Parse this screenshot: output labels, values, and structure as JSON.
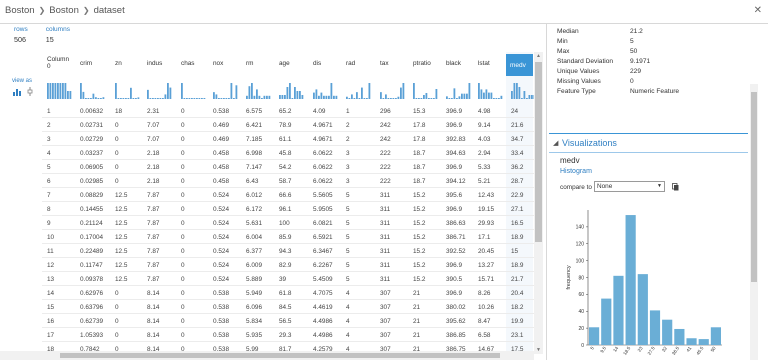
{
  "breadcrumb": {
    "items": [
      "Boston",
      "Boston",
      "dataset"
    ]
  },
  "icons": {
    "close": "close-icon",
    "separator": "chevron-right-icon"
  },
  "summary": {
    "rows_label": "rows",
    "rows_value": "506",
    "columns_label": "columns",
    "columns_value": "15"
  },
  "grid": {
    "view_as_label": "view as",
    "columns": [
      "Column 0",
      "crim",
      "zn",
      "indus",
      "chas",
      "nox",
      "rm",
      "age",
      "dis",
      "rad",
      "tax",
      "ptratio",
      "black",
      "lstat",
      "medv"
    ],
    "selected_column": "medv",
    "rows": [
      [
        "1",
        "0.00632",
        "18",
        "2.31",
        "0",
        "0.538",
        "6.575",
        "65.2",
        "4.09",
        "1",
        "296",
        "15.3",
        "396.9",
        "4.98",
        "24"
      ],
      [
        "2",
        "0.02731",
        "0",
        "7.07",
        "0",
        "0.469",
        "6.421",
        "78.9",
        "4.9671",
        "2",
        "242",
        "17.8",
        "396.9",
        "9.14",
        "21.6"
      ],
      [
        "3",
        "0.02729",
        "0",
        "7.07",
        "0",
        "0.469",
        "7.185",
        "61.1",
        "4.9671",
        "2",
        "242",
        "17.8",
        "392.83",
        "4.03",
        "34.7"
      ],
      [
        "4",
        "0.03237",
        "0",
        "2.18",
        "0",
        "0.458",
        "6.998",
        "45.8",
        "6.0622",
        "3",
        "222",
        "18.7",
        "394.63",
        "2.94",
        "33.4"
      ],
      [
        "5",
        "0.06905",
        "0",
        "2.18",
        "0",
        "0.458",
        "7.147",
        "54.2",
        "6.0622",
        "3",
        "222",
        "18.7",
        "396.9",
        "5.33",
        "36.2"
      ],
      [
        "6",
        "0.02985",
        "0",
        "2.18",
        "0",
        "0.458",
        "6.43",
        "58.7",
        "6.0622",
        "3",
        "222",
        "18.7",
        "394.12",
        "5.21",
        "28.7"
      ],
      [
        "7",
        "0.08829",
        "12.5",
        "7.87",
        "0",
        "0.524",
        "6.012",
        "66.6",
        "5.5605",
        "5",
        "311",
        "15.2",
        "395.6",
        "12.43",
        "22.9"
      ],
      [
        "8",
        "0.14455",
        "12.5",
        "7.87",
        "0",
        "0.524",
        "6.172",
        "96.1",
        "5.9505",
        "5",
        "311",
        "15.2",
        "396.9",
        "19.15",
        "27.1"
      ],
      [
        "9",
        "0.21124",
        "12.5",
        "7.87",
        "0",
        "0.524",
        "5.631",
        "100",
        "6.0821",
        "5",
        "311",
        "15.2",
        "386.63",
        "29.93",
        "16.5"
      ],
      [
        "10",
        "0.17004",
        "12.5",
        "7.87",
        "0",
        "0.524",
        "6.004",
        "85.9",
        "6.5921",
        "5",
        "311",
        "15.2",
        "386.71",
        "17.1",
        "18.9"
      ],
      [
        "11",
        "0.22489",
        "12.5",
        "7.87",
        "0",
        "0.524",
        "6.377",
        "94.3",
        "6.3467",
        "5",
        "311",
        "15.2",
        "392.52",
        "20.45",
        "15"
      ],
      [
        "12",
        "0.11747",
        "12.5",
        "7.87",
        "0",
        "0.524",
        "6.009",
        "82.9",
        "6.2267",
        "5",
        "311",
        "15.2",
        "396.9",
        "13.27",
        "18.9"
      ],
      [
        "13",
        "0.09378",
        "12.5",
        "7.87",
        "0",
        "0.524",
        "5.889",
        "39",
        "5.4509",
        "5",
        "311",
        "15.2",
        "390.5",
        "15.71",
        "21.7"
      ],
      [
        "14",
        "0.62976",
        "0",
        "8.14",
        "0",
        "0.538",
        "5.949",
        "61.8",
        "4.7075",
        "4",
        "307",
        "21",
        "396.9",
        "8.26",
        "20.4"
      ],
      [
        "15",
        "0.63796",
        "0",
        "8.14",
        "0",
        "0.538",
        "6.096",
        "84.5",
        "4.4619",
        "4",
        "307",
        "21",
        "380.02",
        "10.26",
        "18.2"
      ],
      [
        "16",
        "0.62739",
        "0",
        "8.14",
        "0",
        "0.538",
        "5.834",
        "56.5",
        "4.4986",
        "4",
        "307",
        "21",
        "395.62",
        "8.47",
        "19.9"
      ],
      [
        "17",
        "1.05393",
        "0",
        "8.14",
        "0",
        "0.538",
        "5.935",
        "29.3",
        "4.4986",
        "4",
        "307",
        "21",
        "386.85",
        "6.58",
        "23.1"
      ],
      [
        "18",
        "0.7842",
        "0",
        "8.14",
        "0",
        "0.538",
        "5.99",
        "81.7",
        "4.2579",
        "4",
        "307",
        "21",
        "386.75",
        "14.67",
        "17.5"
      ]
    ]
  },
  "stats_panel": {
    "items": [
      {
        "key": "Median",
        "value": "21.2"
      },
      {
        "key": "Min",
        "value": "5"
      },
      {
        "key": "Max",
        "value": "50"
      },
      {
        "key": "Standard Deviation",
        "value": "9.1971"
      },
      {
        "key": "Unique Values",
        "value": "229"
      },
      {
        "key": "Missing Values",
        "value": "0"
      },
      {
        "key": "Feature Type",
        "value": "Numeric Feature"
      }
    ]
  },
  "visualizations": {
    "title": "Visualizations",
    "column_name": "medv",
    "chart_kind": "Histogram",
    "compare_to_label": "compare to",
    "compare_to_value": "None"
  },
  "chart_data": {
    "type": "bar",
    "title": "",
    "xlabel": "",
    "ylabel": "frequency",
    "categories": [
      "5",
      "9.5",
      "14",
      "18.5",
      "23",
      "27.5",
      "32",
      "36.5",
      "41",
      "45.5",
      "50"
    ],
    "values": [
      21,
      55,
      82,
      154,
      84,
      41,
      30,
      19,
      8,
      7,
      21
    ],
    "ylim": [
      0,
      160
    ],
    "yticks": [
      0,
      20,
      40,
      60,
      80,
      100,
      120,
      140
    ],
    "color": "#6aaed6"
  }
}
